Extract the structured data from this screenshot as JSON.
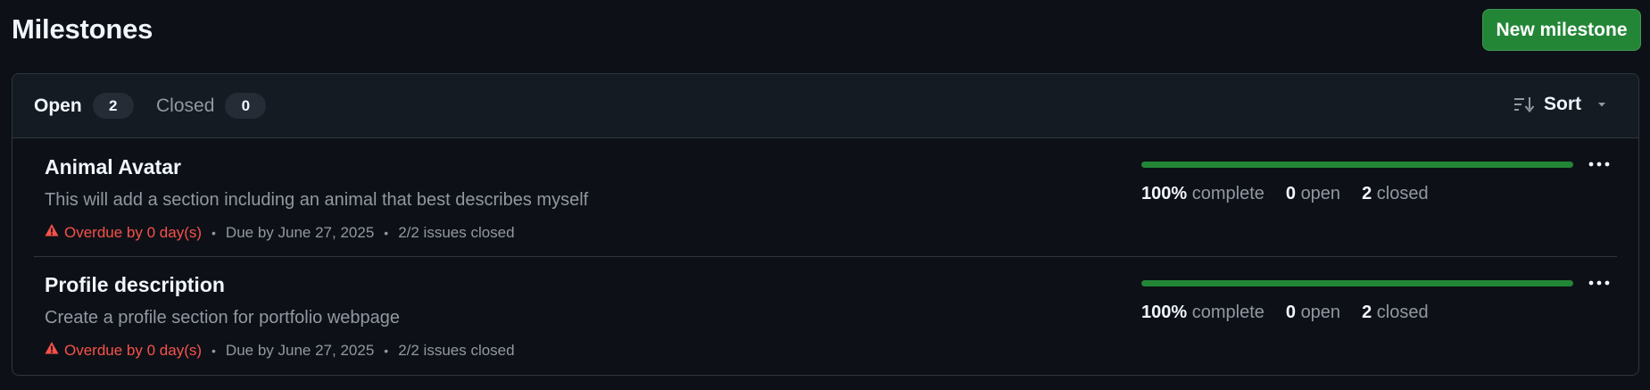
{
  "page_title": "Milestones",
  "new_milestone_label": "New milestone",
  "tabs": {
    "open": {
      "label": "Open",
      "count": "2"
    },
    "closed": {
      "label": "Closed",
      "count": "0"
    }
  },
  "sort_label": "Sort",
  "colors": {
    "accent_green": "#238636",
    "danger_red": "#f85149",
    "background": "#0d1117"
  },
  "milestones": [
    {
      "title": "Animal Avatar",
      "description": "This will add a section including an animal that best describes myself",
      "overdue": "Overdue by 0 day(s)",
      "due": "Due by June 27, 2025",
      "issues_closed": "2/2 issues closed",
      "percent": "100%",
      "complete_label": "complete",
      "open_count": "0",
      "open_label": "open",
      "closed_count": "2",
      "closed_label": "closed",
      "progress_fraction": 1.0,
      "bullet": "•"
    },
    {
      "title": "Profile description",
      "description": "Create a profile section for portfolio webpage",
      "overdue": "Overdue by 0 day(s)",
      "due": "Due by June 27, 2025",
      "issues_closed": "2/2 issues closed",
      "percent": "100%",
      "complete_label": "complete",
      "open_count": "0",
      "open_label": "open",
      "closed_count": "2",
      "closed_label": "closed",
      "progress_fraction": 1.0,
      "bullet": "•"
    }
  ]
}
